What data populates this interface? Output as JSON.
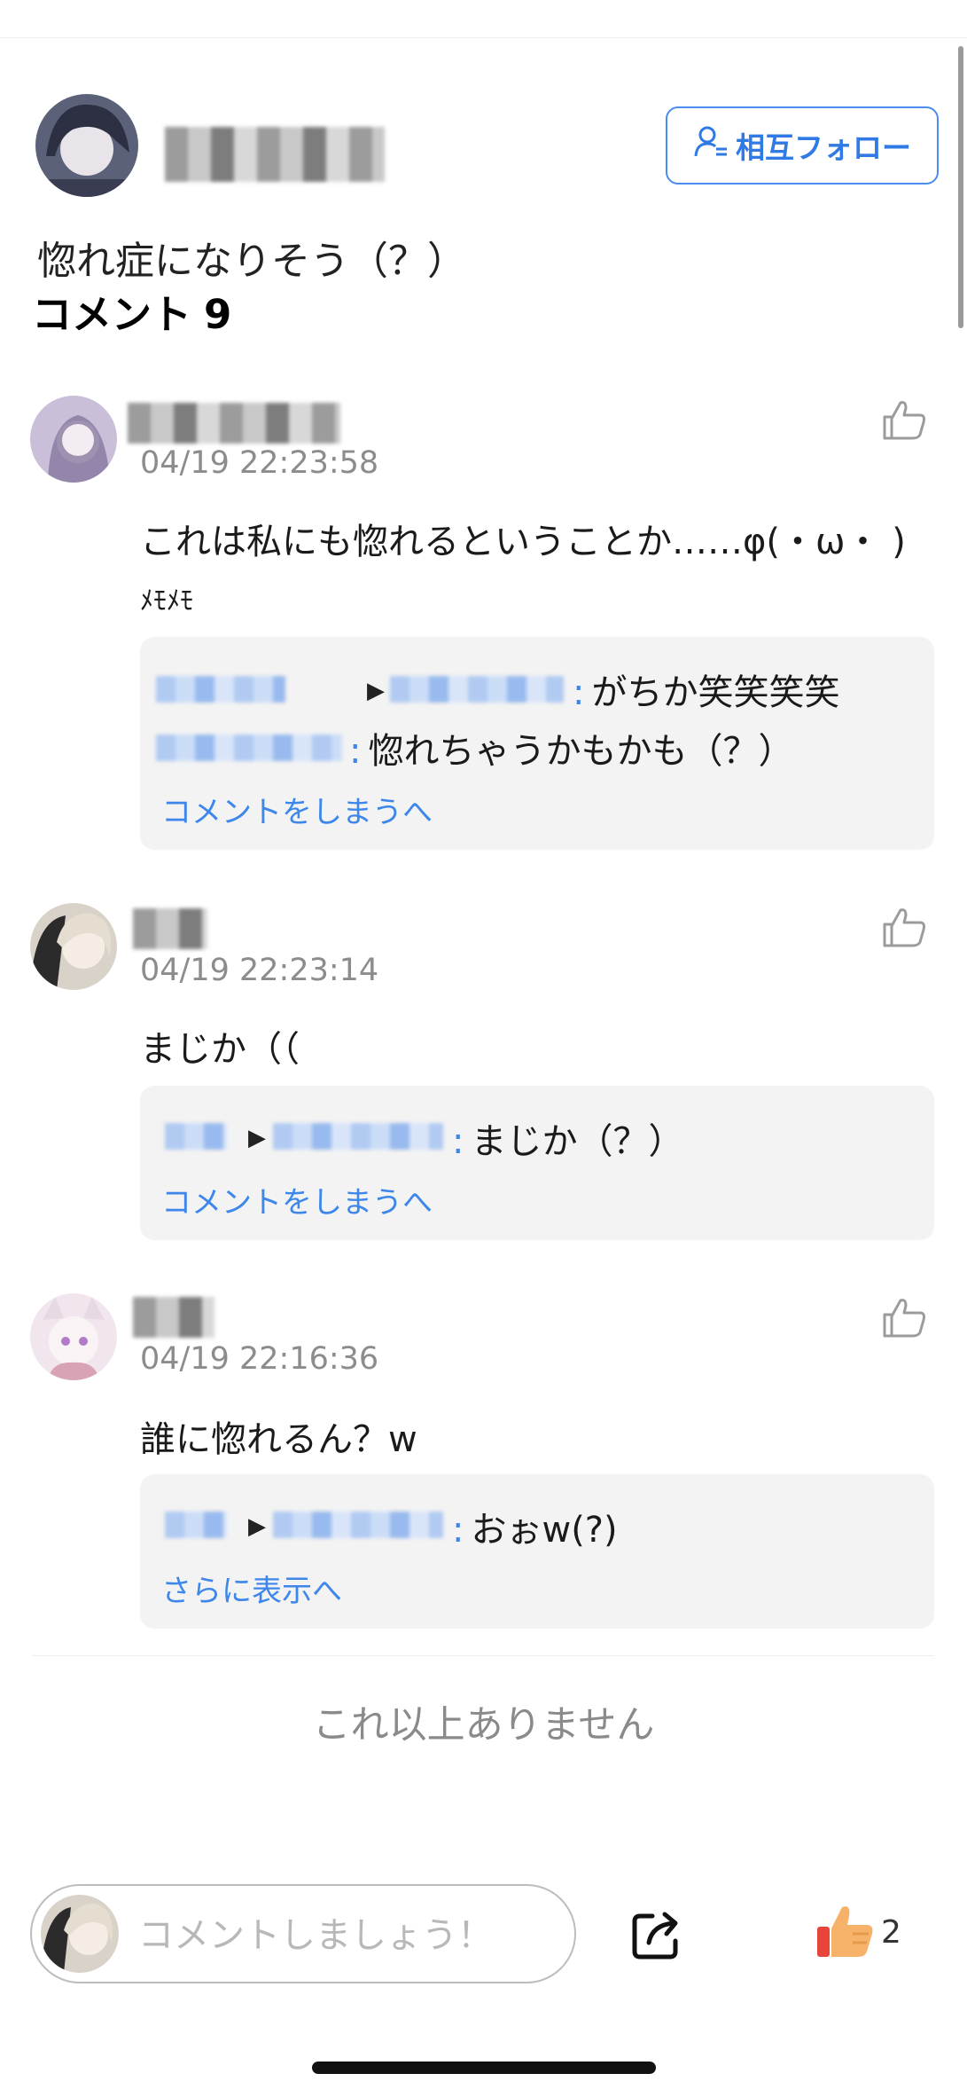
{
  "post": {
    "follow_label": "相互フォロー",
    "text": "惚れ症になりそう（？）",
    "comments_label": "コメント",
    "comments_count": "9"
  },
  "comments": [
    {
      "time": "04/19 22:23:58",
      "text": "これは私にも惚れるということか……φ(・ω・ )",
      "text2": "ﾒﾓﾒﾓ",
      "replies": [
        "がちか笑笑笑笑",
        "惚れちゃうかもかも（？）"
      ],
      "more": "コメントをしまうへ"
    },
    {
      "time": "04/19 22:23:14",
      "text": "まじか（（",
      "replies": [
        "まじか（？）"
      ],
      "more": "コメントをしまうへ"
    },
    {
      "time": "04/19 22:16:36",
      "text": "誰に惚れるん？w",
      "replies": [
        "おぉw(?)"
      ],
      "more": "さらに表示へ"
    }
  ],
  "footer": {
    "no_more": "これ以上ありません",
    "input_placeholder": "コメントしましょう！",
    "like_count": "2"
  },
  "icons": {
    "follow": "person-add-icon",
    "like": "thumbs-up-outline-icon",
    "share": "share-icon",
    "post_like": "thumbs-up-filled-icon"
  },
  "colors": {
    "accent": "#2f7ae5",
    "reply_bg": "#f3f3f3",
    "muted": "#8c8c8c"
  }
}
